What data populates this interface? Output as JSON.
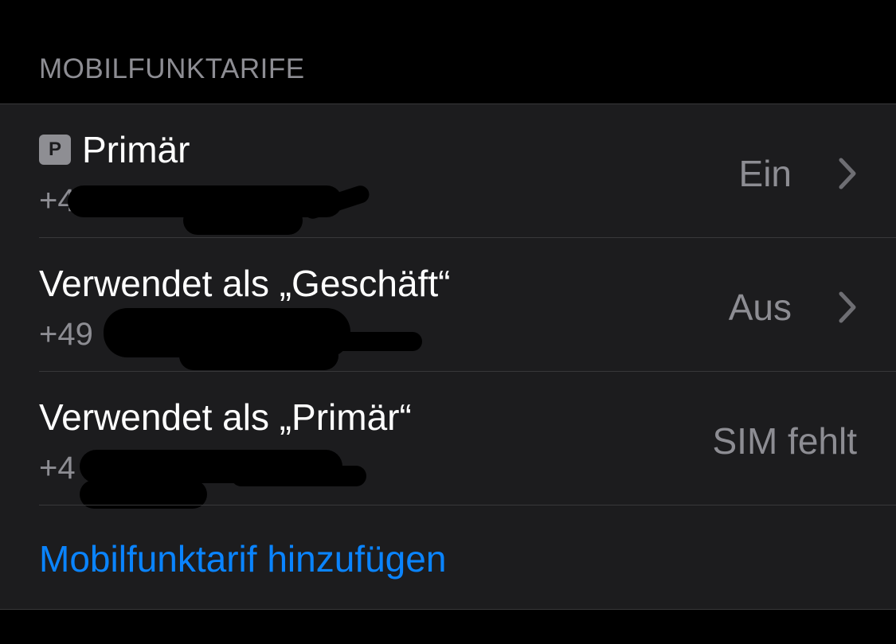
{
  "section": {
    "header": "MOBILFUNKTARIFE"
  },
  "plans": [
    {
      "badge": "P",
      "title": "Primär",
      "number_prefix": "+4",
      "status": "Ein",
      "has_chevron": true
    },
    {
      "title": "Verwendet als „Geschäft“",
      "number_prefix": "+49",
      "status": "Aus",
      "has_chevron": true
    },
    {
      "title": "Verwendet als „Primär“",
      "number_prefix": "+4",
      "status": "SIM fehlt",
      "has_chevron": false
    }
  ],
  "actions": {
    "add_plan_label": "Mobilfunktarif hinzufügen"
  },
  "colors": {
    "background": "#000000",
    "cell": "#1c1c1e",
    "separator": "#38383a",
    "secondary_text": "#8d8d93",
    "accent": "#0a84ff",
    "badge": "#8e8e93"
  },
  "icons": {
    "chevron": "chevron-right-icon",
    "badge": "primary-line-badge-icon"
  }
}
